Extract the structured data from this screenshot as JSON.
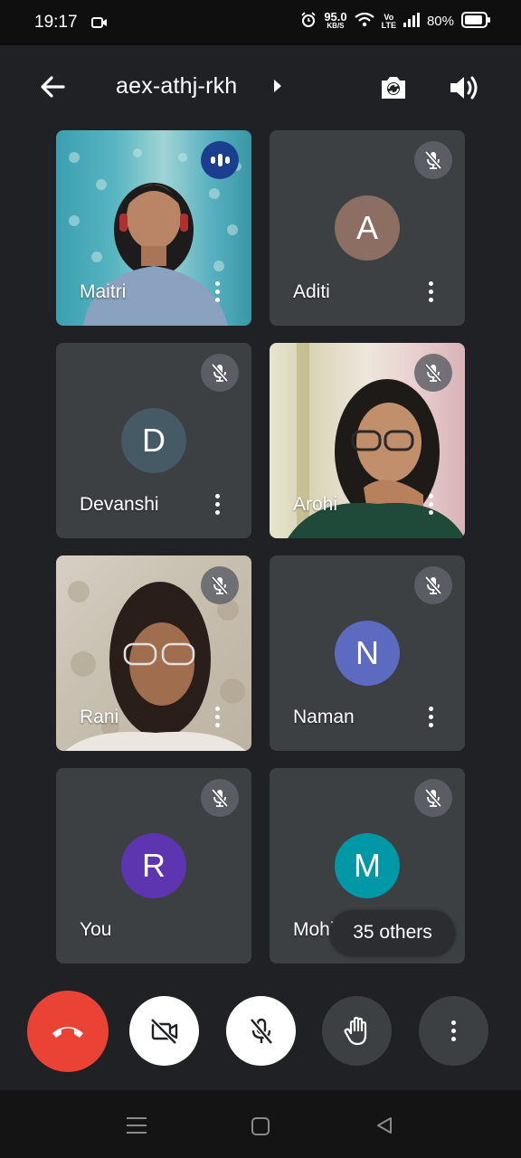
{
  "status_bar": {
    "time": "19:17",
    "net_speed": "95.0",
    "net_unit": "KB/S",
    "volte_top": "Vo",
    "volte_bottom": "LTE",
    "battery": "80%",
    "icons": [
      "screen-record-icon",
      "alarm-icon",
      "wifi-icon",
      "signal-icon",
      "battery-icon"
    ]
  },
  "header": {
    "meeting_code": "aex-athj-rkh",
    "icons": [
      "back-arrow-icon",
      "switch-camera-icon",
      "speaker-icon"
    ]
  },
  "participants": [
    {
      "name": "Maitri",
      "type": "video",
      "state": "speaking"
    },
    {
      "name": "Aditi",
      "type": "avatar",
      "initial": "A",
      "avatar_color": "#8d6e63",
      "state": "muted"
    },
    {
      "name": "Devanshi",
      "type": "avatar",
      "initial": "D",
      "avatar_color": "#455a64",
      "state": "muted"
    },
    {
      "name": "Arohi",
      "type": "video",
      "state": "muted"
    },
    {
      "name": "Rani",
      "type": "video",
      "state": "muted"
    },
    {
      "name": "Naman",
      "type": "avatar",
      "initial": "N",
      "avatar_color": "#5c6bc0",
      "state": "muted"
    },
    {
      "name": "You",
      "type": "avatar",
      "initial": "R",
      "avatar_color": "#5e35b1",
      "state": "muted"
    },
    {
      "name": "Mohit",
      "type": "avatar",
      "initial": "M",
      "avatar_color": "#0097a7",
      "state": "muted"
    }
  ],
  "others_chip": "35 others",
  "controls": {
    "icons": [
      "end-call-icon",
      "camera-off-icon",
      "mic-off-icon",
      "raise-hand-icon",
      "more-options-icon"
    ],
    "hangup_color": "#ea4335"
  },
  "nav_bar": {
    "icons": [
      "recent-apps-icon",
      "home-icon",
      "back-icon"
    ]
  }
}
